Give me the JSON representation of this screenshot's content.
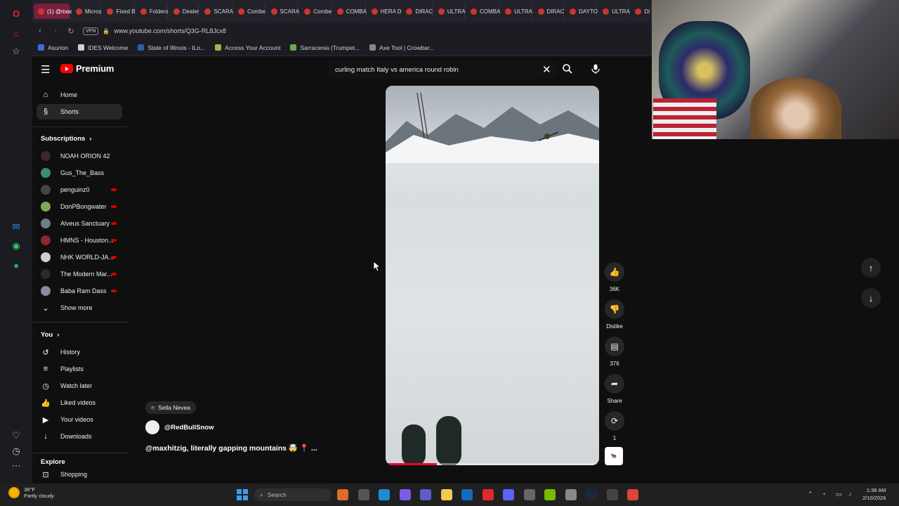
{
  "browser": {
    "tabs": [
      {
        "label": "(1) @max",
        "active": true
      },
      {
        "label": "Micros"
      },
      {
        "label": "Fixed B"
      },
      {
        "label": "Folders"
      },
      {
        "label": "Dealer"
      },
      {
        "label": "SCARA"
      },
      {
        "label": "Combe"
      },
      {
        "label": "SCARA"
      },
      {
        "label": "Combe"
      },
      {
        "label": "COMBA"
      },
      {
        "label": "HERA D"
      },
      {
        "label": "DIRAC"
      },
      {
        "label": "ULTRA"
      },
      {
        "label": "COMBA"
      },
      {
        "label": "ULTRA"
      },
      {
        "label": "DIRAC"
      },
      {
        "label": "DAYTO"
      },
      {
        "label": "ULTRA"
      },
      {
        "label": "Di"
      }
    ],
    "vpn_label": "VPN",
    "url": "www.youtube.com/shorts/Q3G-RL8Jcx8",
    "bookmarks": [
      {
        "label": "Asurion",
        "color": "#3a6fd8"
      },
      {
        "label": "IDES Welcome",
        "color": "#d0d0d0"
      },
      {
        "label": "State of Illinois - ILo...",
        "color": "#2b5fa8"
      },
      {
        "label": "Access Your Account",
        "color": "#a8b04a"
      },
      {
        "label": "Sarracenia (Trumpet...",
        "color": "#6aa84f"
      },
      {
        "label": "Axe Tool | Crowbar...",
        "color": "#888888"
      }
    ]
  },
  "youtube": {
    "logo_text": "Premium",
    "search_query": "curling match Italy vs america round robin",
    "sidebar": {
      "main": [
        {
          "label": "Home",
          "icon": "home-icon",
          "glyph": "⌂"
        },
        {
          "label": "Shorts",
          "icon": "shorts-icon",
          "glyph": "§",
          "active": true
        }
      ],
      "subscriptions_title": "Subscriptions",
      "subscriptions": [
        {
          "label": "NOAH ORION 42",
          "color": "#3a2a2a",
          "live": false
        },
        {
          "label": "Gus_The_Bass",
          "color": "#3c8f6b",
          "live": false
        },
        {
          "label": "penguinz0",
          "color": "#444444",
          "live": true
        },
        {
          "label": "DonPBongwater",
          "color": "#7aa85c",
          "live": true
        },
        {
          "label": "Alveus Sanctuary",
          "color": "#6a7f8a",
          "live": true
        },
        {
          "label": "HMNS - Houston...",
          "color": "#8a2a2a",
          "live": true
        },
        {
          "label": "NHK WORLD-JA...",
          "color": "#cfcfcf",
          "live": true
        },
        {
          "label": "The Modern Mar...",
          "color": "#2a2a2a",
          "live": true
        },
        {
          "label": "Baba Ram Dass",
          "color": "#8a8a9a",
          "live": true
        }
      ],
      "show_more": "Show more",
      "you_title": "You",
      "you_items": [
        {
          "label": "History",
          "icon": "history-icon",
          "glyph": "↺"
        },
        {
          "label": "Playlists",
          "icon": "playlists-icon",
          "glyph": "≡"
        },
        {
          "label": "Watch later",
          "icon": "watch-later-icon",
          "glyph": "◷"
        },
        {
          "label": "Liked videos",
          "icon": "like-icon",
          "glyph": "👍"
        },
        {
          "label": "Your videos",
          "icon": "your-videos-icon",
          "glyph": "▶"
        },
        {
          "label": "Downloads",
          "icon": "download-icon",
          "glyph": "↓"
        }
      ],
      "explore_title": "Explore",
      "explore_next": "Shopping"
    },
    "short": {
      "location": "Sella Nevea",
      "channel": "@RedBullSnow",
      "title": "@maxhitzig, literally gapping mountains 🤯 📍 ...",
      "progress": 0.24,
      "actions": {
        "likes": "36K",
        "dislike": "Dislike",
        "comments": "376",
        "share": "Share",
        "remix": "1"
      },
      "channel_badge": "Red Bull"
    }
  },
  "taskbar": {
    "weather_temp": "38°F",
    "weather_desc": "Partly cloudy",
    "search_placeholder": "Search",
    "time": "1:38 AM",
    "date": "2/10/2026",
    "apps": [
      {
        "icon": "pizza-app-icon",
        "color": "#e06a2a"
      },
      {
        "icon": "task-view-icon",
        "color": "#555555"
      },
      {
        "icon": "edge-icon",
        "color": "#1f8ad6"
      },
      {
        "icon": "copilot-icon",
        "color": "#7a5ce0"
      },
      {
        "icon": "teams-icon",
        "color": "#5b5fc7"
      },
      {
        "icon": "file-explorer-icon",
        "color": "#f2c94c"
      },
      {
        "icon": "outlook-icon",
        "color": "#0f6cbd"
      },
      {
        "icon": "opera-icon",
        "color": "#e0282e"
      },
      {
        "icon": "discord-icon",
        "color": "#5865f2"
      },
      {
        "icon": "app-icon",
        "color": "#666666"
      },
      {
        "icon": "nvidia-icon",
        "color": "#76b900"
      },
      {
        "icon": "settings-icon",
        "color": "#888888"
      },
      {
        "icon": "steam-icon",
        "color": "#1b2838"
      },
      {
        "icon": "terminal-icon",
        "color": "#444444"
      },
      {
        "icon": "chrome-icon",
        "color": "#db4437"
      }
    ]
  }
}
